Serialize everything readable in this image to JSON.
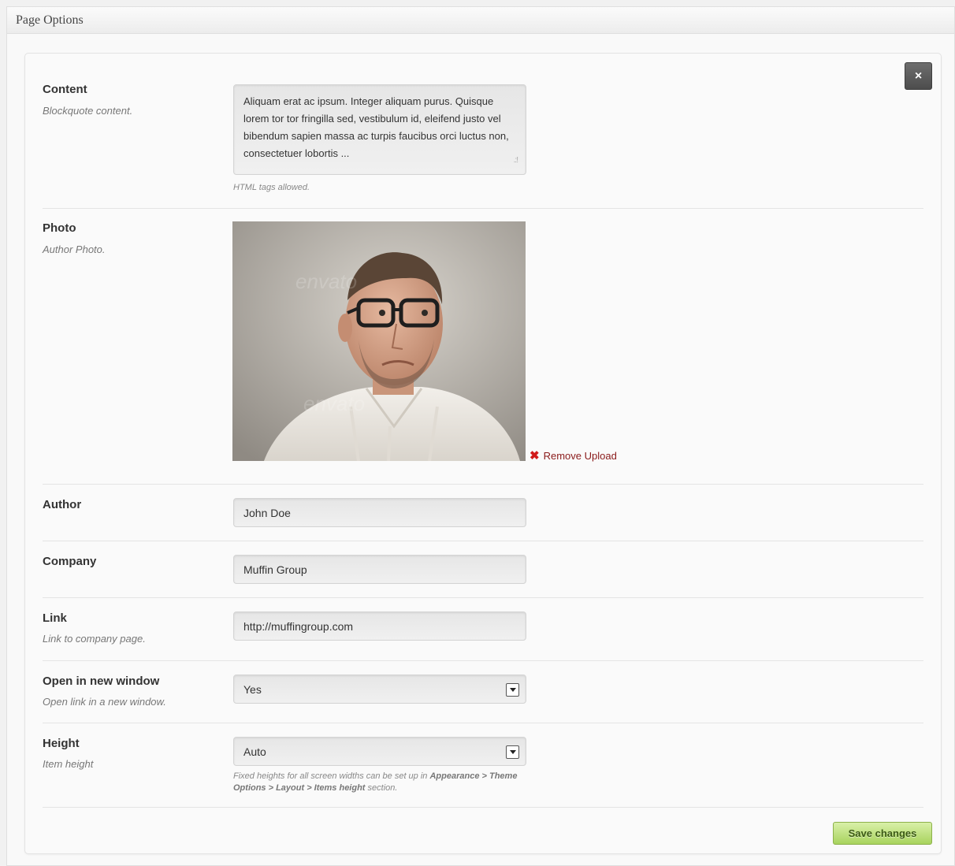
{
  "metabox": {
    "title": "Page Options"
  },
  "close_icon": "close-icon",
  "close_label": "×",
  "fields": {
    "content": {
      "label": "Content",
      "desc": "Blockquote content.",
      "value": "Aliquam erat ac ipsum. Integer aliquam purus. Quisque lorem tor tor fringilla sed, vestibulum id, eleifend justo vel bibendum sapien massa ac turpis faucibus orci luctus non, consectetuer lobortis ...",
      "hint": "HTML tags allowed."
    },
    "photo": {
      "label": "Photo",
      "desc": "Author Photo.",
      "remove_label": "Remove Upload",
      "remove_icon": "remove-x-icon",
      "watermark": "envato"
    },
    "author": {
      "label": "Author",
      "value": "John Doe"
    },
    "company": {
      "label": "Company",
      "value": "Muffin Group"
    },
    "link": {
      "label": "Link",
      "desc": "Link to company page.",
      "value": "http://muffingroup.com"
    },
    "new_window": {
      "label": "Open in new window",
      "desc": "Open link in a new window.",
      "value": "Yes"
    },
    "height": {
      "label": "Height",
      "desc": "Item height",
      "value": "Auto",
      "hint_prefix": "Fixed heights for all screen widths can be set up in",
      "hint_path": "Appearance > Theme Options > Layout > Items height",
      "hint_suffix": "section."
    }
  },
  "save_label": "Save changes",
  "colors": {
    "save_button": "#a8d35e",
    "close_button": "#5a5a5a",
    "remove_link": "#8a1a1a"
  }
}
